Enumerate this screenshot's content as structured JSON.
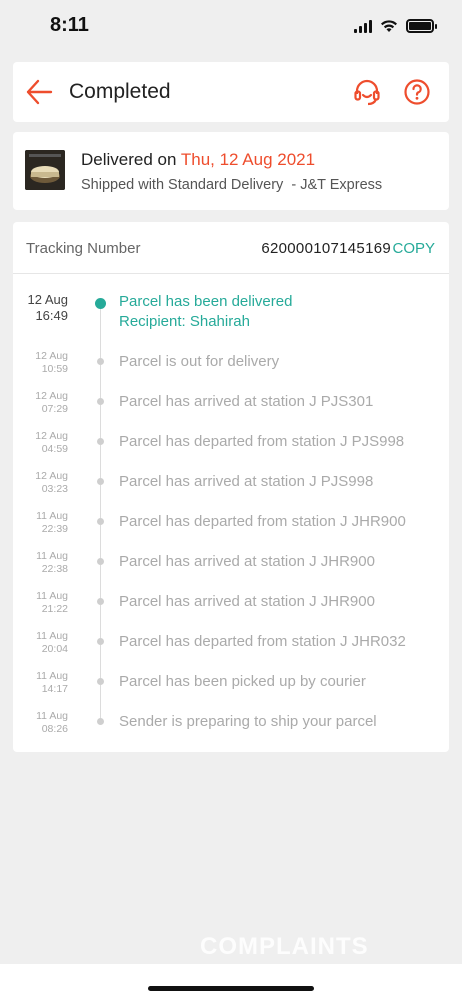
{
  "status_bar": {
    "time": "8:11"
  },
  "header": {
    "title": "Completed"
  },
  "delivery": {
    "status_prefix": "Delivered on ",
    "date": "Thu, 12 Aug 2021",
    "shipping": "Shipped with Standard Delivery  - J&T Express"
  },
  "tracking": {
    "label": "Tracking Number",
    "number": "620000107145169",
    "copy_label": "COPY"
  },
  "events": [
    {
      "date": "12 Aug",
      "time": "16:49",
      "text": "Parcel has been delivered",
      "subtext": "Recipient: Shahirah",
      "current": true
    },
    {
      "date": "12 Aug",
      "time": "10:59",
      "text": "Parcel is out for delivery"
    },
    {
      "date": "12 Aug",
      "time": "07:29",
      "text": "Parcel has arrived at station J PJS301"
    },
    {
      "date": "12 Aug",
      "time": "04:59",
      "text": "Parcel has departed from station J PJS998"
    },
    {
      "date": "12 Aug",
      "time": "03:23",
      "text": "Parcel has arrived at station J PJS998"
    },
    {
      "date": "11 Aug",
      "time": "22:39",
      "text": "Parcel has departed from station J JHR900"
    },
    {
      "date": "11 Aug",
      "time": "22:38",
      "text": "Parcel has arrived at station J JHR900"
    },
    {
      "date": "11 Aug",
      "time": "21:22",
      "text": "Parcel has arrived at station J JHR900"
    },
    {
      "date": "11 Aug",
      "time": "20:04",
      "text": "Parcel has departed from station J JHR032"
    },
    {
      "date": "11 Aug",
      "time": "14:17",
      "text": "Parcel has been picked up by courier"
    },
    {
      "date": "11 Aug",
      "time": "08:26",
      "text": "Sender is preparing to ship your parcel"
    }
  ],
  "watermark": "COMPLAINTS",
  "colors": {
    "accent": "#ee4d2d",
    "teal": "#26aa99"
  },
  "icons": {
    "back": "back-arrow-icon",
    "support": "headset-icon",
    "help": "question-circle-icon"
  }
}
